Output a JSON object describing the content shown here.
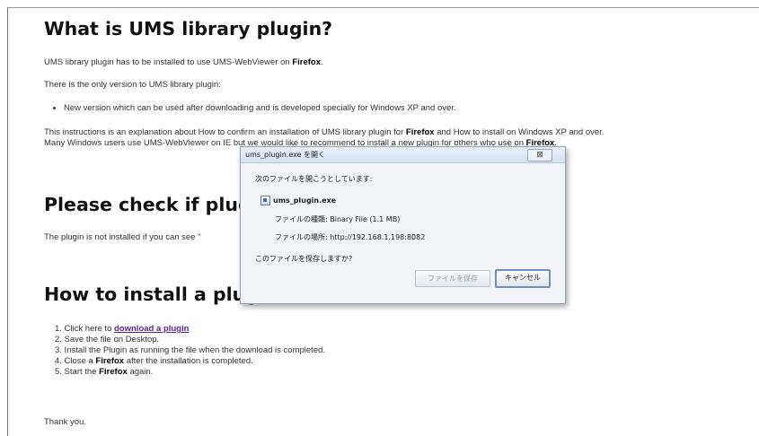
{
  "page": {
    "heading1": "What is UMS library plugin?",
    "p1_text": "UMS library plugin has to be installed to use UMS-WebViewer on ",
    "p1_bold": "Firefox",
    "p1_end": ".",
    "p2": "There is the only version to UMS library plugin:",
    "bullet1": "New version which can be used after downloading and is developed specially for Windows XP and over.",
    "p3_text": "This instructions is an explanation about How to confirm an installation of UMS library plugin for ",
    "p3_bold1": "Firefox",
    "p3_mid": " and How to install on Windows XP and over.",
    "p4_text": "Many Windows users use UMS-WebViewer on IE but we would like to recommend to install a new plugin for others who use on ",
    "p4_bold": "Firefox",
    "p4_end": ".",
    "heading2": "Please check if plugin is installed",
    "p5": "The plugin is not installed if you can see \"",
    "heading3": "How to install a plugin",
    "step1_pre": "1. Click here to ",
    "step1_link": "download a plugin",
    "step2": "2. Save the file on Desktop.",
    "step3": "3. Install the Plugin as running the file when the download is completed.",
    "step4_pre": "4. Close a ",
    "step4_bold": "Firefox",
    "step4_post": " after the installation is completed.",
    "step5_pre": "5. Start the ",
    "step5_bold": "Firefox",
    "step5_post": " again.",
    "thanks": "Thank you."
  },
  "dialog": {
    "title": "ums_plugin.exe を開く",
    "close": "⊠",
    "opening_msg": "次のファイルを開こうとしています:",
    "filename": "ums_plugin.exe",
    "type_line": "ファイルの種類: Binary File (1.1 MB)",
    "source_line": "ファイルの場所: http://192.168.1.198:8082",
    "question": "このファイルを保存しますか?",
    "save_button": "ファイルを保存",
    "cancel_button": "キャンセル"
  }
}
